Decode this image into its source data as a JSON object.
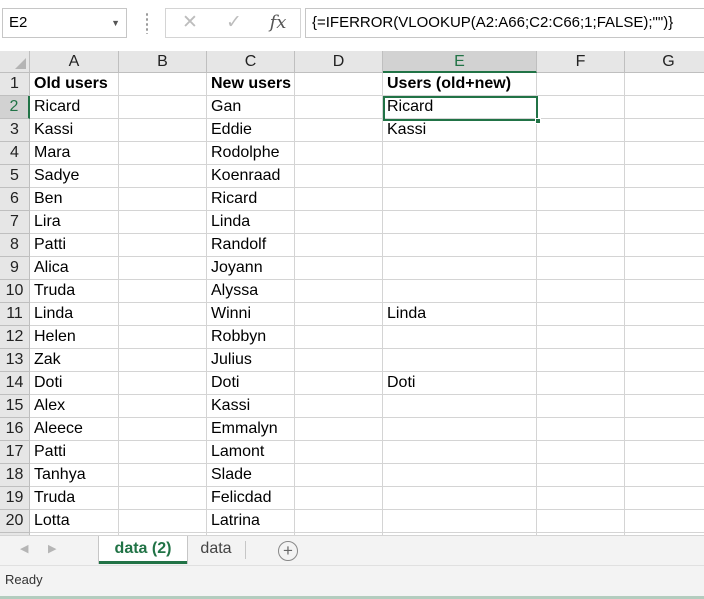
{
  "formula_bar": {
    "name_box": "E2",
    "cancel_icon": "✕",
    "enter_icon": "✓",
    "function_icon": "fx",
    "formula": "{=IFERROR(VLOOKUP(A2:A66;C2:C66;1;FALSE);\"\")}"
  },
  "grid": {
    "columns": [
      "A",
      "B",
      "C",
      "D",
      "E",
      "F",
      "G"
    ],
    "selected_column": "E",
    "selected_row": 2,
    "active_cell": "E2",
    "rows": [
      {
        "n": "1",
        "A": "Old users",
        "C": "New users",
        "E": "Users (old+new)"
      },
      {
        "n": "2",
        "A": "Ricard",
        "C": "Gan",
        "E": "Ricard"
      },
      {
        "n": "3",
        "A": "Kassi",
        "C": "Eddie",
        "E": "Kassi"
      },
      {
        "n": "4",
        "A": "Mara",
        "C": "Rodolphe",
        "E": ""
      },
      {
        "n": "5",
        "A": "Sadye",
        "C": "Koenraad",
        "E": ""
      },
      {
        "n": "6",
        "A": "Ben",
        "C": "Ricard",
        "E": ""
      },
      {
        "n": "7",
        "A": "Lira",
        "C": "Linda",
        "E": ""
      },
      {
        "n": "8",
        "A": "Patti",
        "C": "Randolf",
        "E": ""
      },
      {
        "n": "9",
        "A": "Alica",
        "C": "Joyann",
        "E": ""
      },
      {
        "n": "10",
        "A": "Truda",
        "C": "Alyssa",
        "E": ""
      },
      {
        "n": "11",
        "A": "Linda",
        "C": "Winni",
        "E": "Linda"
      },
      {
        "n": "12",
        "A": "Helen",
        "C": "Robbyn",
        "E": ""
      },
      {
        "n": "13",
        "A": "Zak",
        "C": "Julius",
        "E": ""
      },
      {
        "n": "14",
        "A": "Doti",
        "C": "Doti",
        "E": "Doti"
      },
      {
        "n": "15",
        "A": "Alex",
        "C": "Kassi",
        "E": ""
      },
      {
        "n": "16",
        "A": "Aleece",
        "C": "Emmalyn",
        "E": ""
      },
      {
        "n": "17",
        "A": "Patti",
        "C": "Lamont",
        "E": ""
      },
      {
        "n": "18",
        "A": "Tanhya",
        "C": "Slade",
        "E": ""
      },
      {
        "n": "19",
        "A": "Truda",
        "C": "Felicdad",
        "E": ""
      },
      {
        "n": "20",
        "A": "Lotta",
        "C": "Latrina",
        "E": ""
      },
      {
        "n": "21",
        "A": "",
        "C": "",
        "E": ""
      }
    ]
  },
  "sheet_tabs": {
    "tabs": [
      {
        "label": "data (2)",
        "active": true
      },
      {
        "label": "data",
        "active": false
      }
    ],
    "add_sheet_icon": "+"
  },
  "status_bar": {
    "status": "Ready"
  },
  "colors": {
    "accent": "#217346",
    "header_bg": "#e6e6e6",
    "gridline": "#d4d4d4"
  }
}
